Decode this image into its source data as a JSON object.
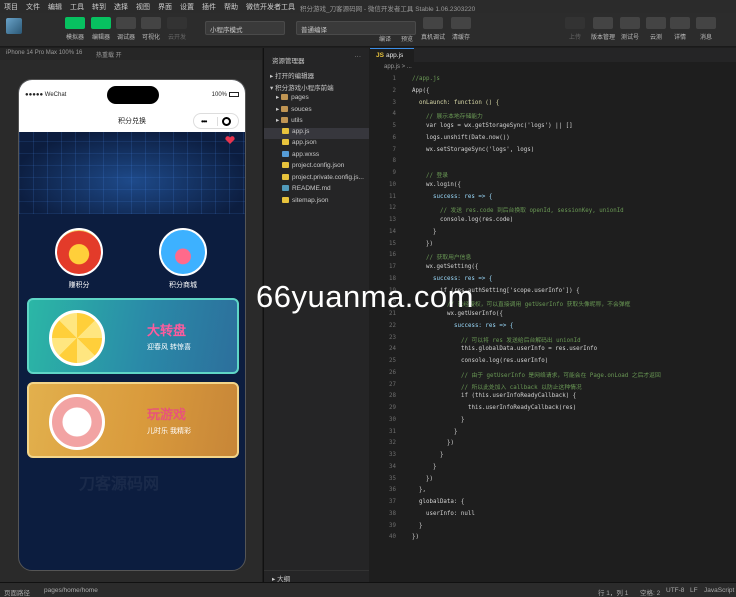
{
  "menu": [
    "项目",
    "文件",
    "编辑",
    "工具",
    "转到",
    "选择",
    "视图",
    "界面",
    "设置",
    "插件",
    "帮助",
    "微信开发者工具"
  ],
  "window_title": "积分游戏_刀客源码网 - 微信开发者工具 Stable 1.06.2303220",
  "toolbar": {
    "left_buttons": [
      "模拟器",
      "编辑器",
      "调试器",
      "可视化",
      "云开发"
    ],
    "mode_select": "小程序模式",
    "compile_select": "普通编译",
    "mid_buttons": [
      "编译",
      "预览",
      "真机调试",
      "清缓存"
    ],
    "right_buttons": [
      "上传",
      "版本管理",
      "测试号",
      "云测",
      "详情",
      "消息"
    ]
  },
  "simulator_bar": {
    "device": "iPhone 14 Pro Max 100% 16",
    "hotreload": "热重载 开"
  },
  "phone": {
    "carrier": "●●●●● WeChat",
    "battery": "100%",
    "page_title": "积分兑换",
    "capsule_dots": "•••",
    "icons": [
      {
        "label": "赚积分"
      },
      {
        "label": "积分商城"
      }
    ],
    "cards": [
      {
        "title": "大转盘",
        "subtitle": "迎春风  转惊喜"
      },
      {
        "title": "玩游戏",
        "subtitle": "儿时乐  我精彩"
      }
    ],
    "game_watermark": "刀客源码网"
  },
  "explorer": {
    "header": "资源管理器",
    "open_editors": "打开的编辑器",
    "project": "积分游戏小程序前端",
    "items": [
      {
        "name": "pages",
        "type": "folder"
      },
      {
        "name": "souces",
        "type": "folder"
      },
      {
        "name": "utils",
        "type": "folder"
      },
      {
        "name": "app.js",
        "type": "js"
      },
      {
        "name": "app.json",
        "type": "json"
      },
      {
        "name": "app.wxss",
        "type": "wxss"
      },
      {
        "name": "project.config.json",
        "type": "json"
      },
      {
        "name": "project.private.config.js...",
        "type": "json"
      },
      {
        "name": "README.md",
        "type": "md"
      },
      {
        "name": "sitemap.json",
        "type": "json"
      }
    ],
    "outline": "大纲"
  },
  "editor": {
    "tab": "app.js",
    "breadcrumb": "app.js > ...",
    "lines": [
      {
        "n": "1",
        "t": "//app.js",
        "c": "cm",
        "i": 0
      },
      {
        "n": "2",
        "t": "App({",
        "c": "",
        "i": 0
      },
      {
        "n": "3",
        "t": "onLaunch: function () {",
        "c": "fn",
        "i": 1
      },
      {
        "n": "4",
        "t": "// 展示本地存储能力",
        "c": "cm",
        "i": 2
      },
      {
        "n": "5",
        "t": "var logs = wx.getStorageSync('logs') || []",
        "c": "",
        "i": 2
      },
      {
        "n": "6",
        "t": "logs.unshift(Date.now())",
        "c": "",
        "i": 2
      },
      {
        "n": "7",
        "t": "wx.setStorageSync('logs', logs)",
        "c": "",
        "i": 2
      },
      {
        "n": "8",
        "t": "",
        "c": "",
        "i": 0
      },
      {
        "n": "9",
        "t": "// 登录",
        "c": "cm",
        "i": 2
      },
      {
        "n": "10",
        "t": "wx.login({",
        "c": "",
        "i": 2
      },
      {
        "n": "11",
        "t": "success: res => {",
        "c": "prop",
        "i": 3
      },
      {
        "n": "12",
        "t": "// 发送 res.code 到后台换取 openId, sessionKey, unionId",
        "c": "cm",
        "i": 4
      },
      {
        "n": "13",
        "t": "console.log(res.code)",
        "c": "",
        "i": 4
      },
      {
        "n": "14",
        "t": "}",
        "c": "",
        "i": 3
      },
      {
        "n": "15",
        "t": "})",
        "c": "",
        "i": 2
      },
      {
        "n": "16",
        "t": "// 获取用户信息",
        "c": "cm",
        "i": 2
      },
      {
        "n": "17",
        "t": "wx.getSetting({",
        "c": "",
        "i": 2
      },
      {
        "n": "18",
        "t": "success: res => {",
        "c": "prop",
        "i": 3
      },
      {
        "n": "19",
        "t": "if (res.authSetting['scope.userInfo']) {",
        "c": "",
        "i": 4
      },
      {
        "n": "20",
        "t": "// 已经授权，可以直接调用 getUserInfo 获取头像昵称，不会弹框",
        "c": "cm",
        "i": 5
      },
      {
        "n": "21",
        "t": "wx.getUserInfo({",
        "c": "",
        "i": 5
      },
      {
        "n": "22",
        "t": "success: res => {",
        "c": "prop",
        "i": 6
      },
      {
        "n": "23",
        "t": "// 可以将 res 发送给后台解码出 unionId",
        "c": "cm",
        "i": 7
      },
      {
        "n": "24",
        "t": "this.globalData.userInfo = res.userInfo",
        "c": "",
        "i": 7
      },
      {
        "n": "25",
        "t": "console.log(res.userInfo)",
        "c": "",
        "i": 7
      },
      {
        "n": "26",
        "t": "// 由于 getUserInfo 是网络请求，可能会在 Page.onLoad 之后才返回",
        "c": "cm",
        "i": 7
      },
      {
        "n": "27",
        "t": "// 所以此处加入 callback 以防止这种情况",
        "c": "cm",
        "i": 7
      },
      {
        "n": "28",
        "t": "if (this.userInfoReadyCallback) {",
        "c": "",
        "i": 7
      },
      {
        "n": "29",
        "t": "this.userInfoReadyCallback(res)",
        "c": "",
        "i": 8
      },
      {
        "n": "30",
        "t": "}",
        "c": "",
        "i": 7
      },
      {
        "n": "31",
        "t": "}",
        "c": "",
        "i": 6
      },
      {
        "n": "32",
        "t": "})",
        "c": "",
        "i": 5
      },
      {
        "n": "33",
        "t": "}",
        "c": "",
        "i": 4
      },
      {
        "n": "34",
        "t": "}",
        "c": "",
        "i": 3
      },
      {
        "n": "35",
        "t": "})",
        "c": "",
        "i": 2
      },
      {
        "n": "36",
        "t": "},",
        "c": "",
        "i": 1
      },
      {
        "n": "37",
        "t": "globalData: {",
        "c": "",
        "i": 1
      },
      {
        "n": "38",
        "t": "userInfo: null",
        "c": "",
        "i": 2
      },
      {
        "n": "39",
        "t": "}",
        "c": "",
        "i": 1
      },
      {
        "n": "40",
        "t": "})",
        "c": "",
        "i": 0
      }
    ]
  },
  "statusbar": {
    "left": "页面路径",
    "path": "pages/home/home",
    "position": "行 1，列 1",
    "spaces": "空格: 2",
    "encoding": "UTF-8",
    "eol": "LF",
    "lang": "JavaScript"
  },
  "watermark": "66yuanma.com"
}
